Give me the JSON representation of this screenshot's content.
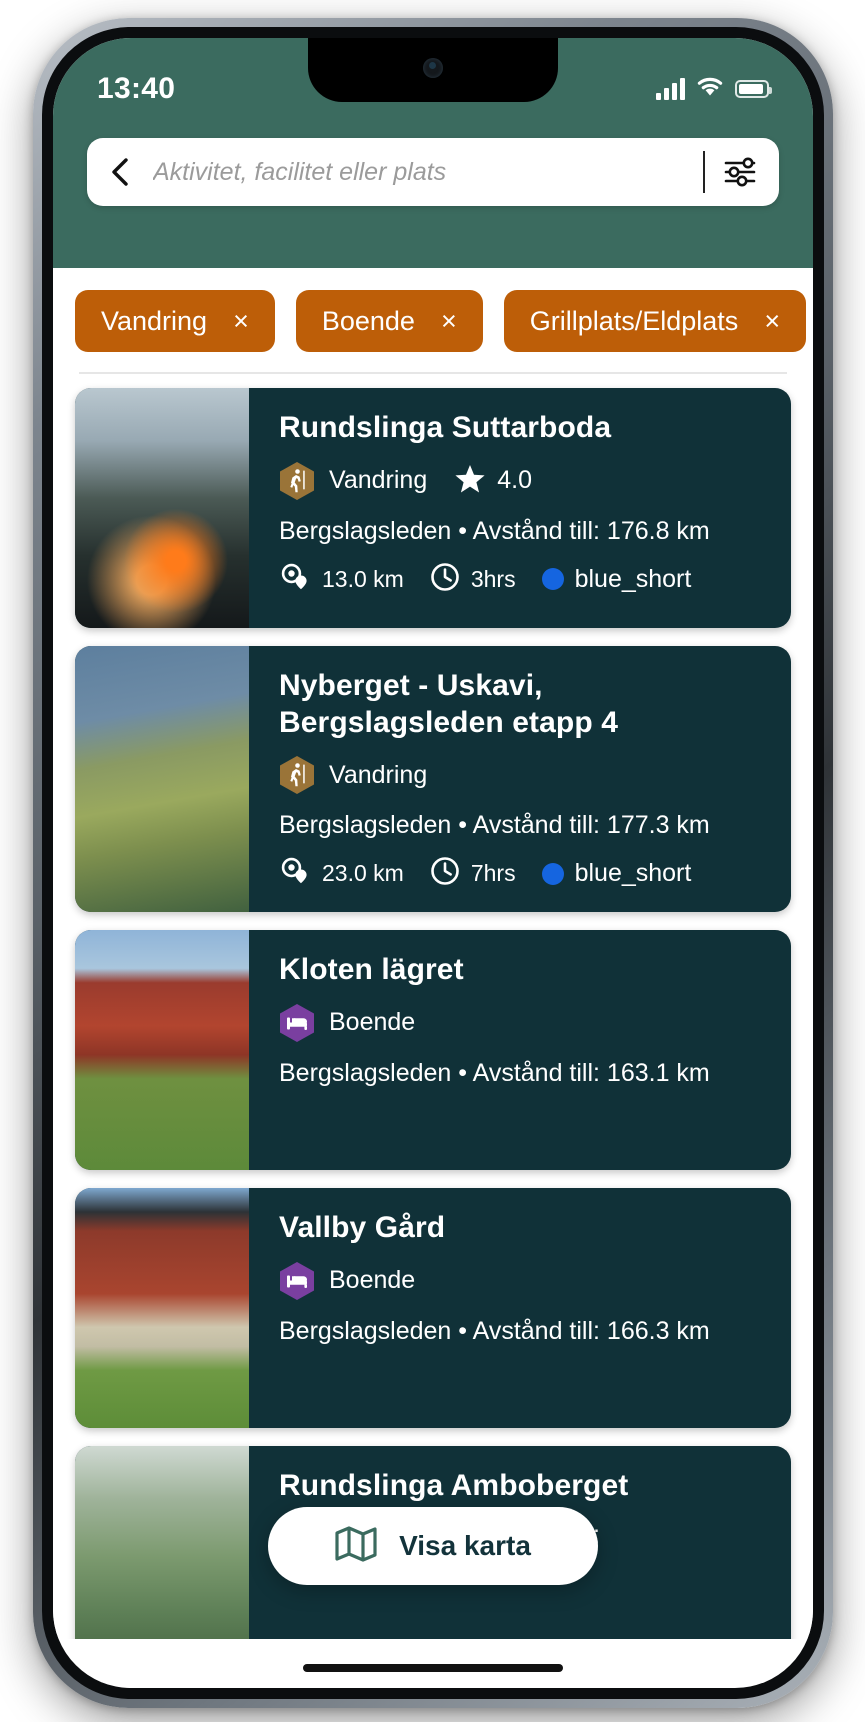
{
  "status_bar": {
    "time": "13:40",
    "signal_icon": "signal-bars-icon",
    "wifi_icon": "wifi-icon",
    "battery_icon": "battery-icon"
  },
  "header": {
    "back_icon": "chevron-left-icon",
    "search": {
      "placeholder": "Aktivitet, facilitet eller plats",
      "value": ""
    },
    "filter_icon": "filter-sliders-icon"
  },
  "filters": {
    "chips": [
      {
        "label": "Vandring",
        "remove": "×"
      },
      {
        "label": "Boende",
        "remove": "×"
      },
      {
        "label": "Grillplats/Eldplats",
        "remove": "×"
      }
    ]
  },
  "results": [
    {
      "title": "Rundslinga Suttarboda",
      "category": "Vandring",
      "category_icon": "hiker-hexagon-icon",
      "category_color": "#9a7438",
      "rating": "4.0",
      "rating_icon": "star-icon",
      "subtitle": "Bergslagsleden • Avstånd till: 176.8 km",
      "distance": "13.0 km",
      "distance_icon": "map-pin-icon",
      "duration": "3hrs",
      "duration_icon": "clock-icon",
      "trail": "blue_short",
      "trail_color": "#1565e0",
      "photo": "grill-fire-photo"
    },
    {
      "title": "Nyberget - Uskavi, Bergslagsleden etapp 4",
      "category": "Vandring",
      "category_icon": "hiker-hexagon-icon",
      "category_color": "#9a7438",
      "rating": "",
      "rating_icon": "",
      "subtitle": "Bergslagsleden • Avstånd till: 177.3 km",
      "distance": "23.0 km",
      "distance_icon": "map-pin-icon",
      "duration": "7hrs",
      "duration_icon": "clock-icon",
      "trail": "blue_short",
      "trail_color": "#1565e0",
      "photo": "boardwalk-lake-photo"
    },
    {
      "title": "Kloten lägret",
      "category": "Boende",
      "category_icon": "bed-hexagon-icon",
      "category_color": "#7a3fa0",
      "rating": "",
      "rating_icon": "",
      "subtitle": "Bergslagsleden • Avstånd till: 163.1 km",
      "distance": "",
      "duration": "",
      "trail": "",
      "photo": "red-cottage-photo"
    },
    {
      "title": "Vallby Gård",
      "category": "Boende",
      "category_icon": "bed-hexagon-icon",
      "category_color": "#7a3fa0",
      "rating": "",
      "rating_icon": "",
      "subtitle": "Bergslagsleden • Avstånd till: 166.3 km",
      "distance": "",
      "duration": "",
      "trail": "",
      "photo": "red-barn-photo"
    },
    {
      "title": "Rundslinga Amboberget",
      "category": "",
      "category_icon": "",
      "category_color": "",
      "rating": "",
      "rating_icon": "",
      "subtitle": "Bergslagsleden • Avstånd till:",
      "distance": "",
      "duration": "",
      "trail": "",
      "photo": "forest-hikers-photo"
    }
  ],
  "map_button": {
    "label": "Visa karta",
    "icon": "map-icon"
  },
  "colors": {
    "header_green": "#3b6b5f",
    "card_dark": "#103138",
    "chip_orange": "#bd5e08",
    "accent_blue": "#1565e0",
    "map_icon_green": "#3b6b5f"
  }
}
